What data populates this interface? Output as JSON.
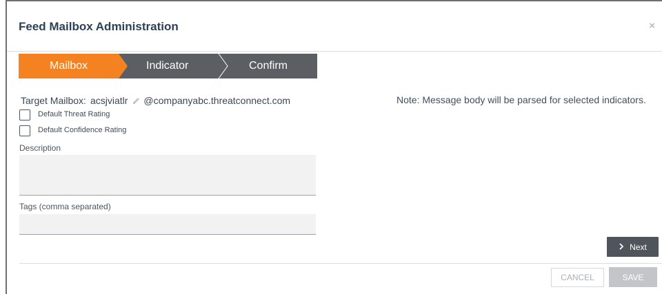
{
  "dialog": {
    "title": "Feed Mailbox Administration",
    "close_icon": "close-icon",
    "close_symbol": "×"
  },
  "wizard": {
    "steps": [
      {
        "label": "Mailbox",
        "active": true
      },
      {
        "label": "Indicator",
        "active": false
      },
      {
        "label": "Confirm",
        "active": false
      }
    ],
    "colors": {
      "active": "#f58220",
      "inactive": "#5b5f64",
      "separator": "#ffffff"
    }
  },
  "form": {
    "target_label": "Target Mailbox:",
    "target_value": "acsjviatlr",
    "edit_icon": "pencil-icon",
    "target_domain": "@companyabc.threatconnect.com",
    "checkboxes": [
      {
        "label": "Default Threat Rating",
        "checked": false
      },
      {
        "label": "Default Confidence Rating",
        "checked": false
      }
    ],
    "description_label": "Description",
    "description_value": "",
    "tags_label": "Tags (comma separated)",
    "tags_value": ""
  },
  "note": "Note: Message body will be parsed for selected indicators.",
  "buttons": {
    "next_label": "Next",
    "next_icon": "chevron-right-icon",
    "cancel_label": "CANCEL",
    "save_label": "SAVE"
  }
}
